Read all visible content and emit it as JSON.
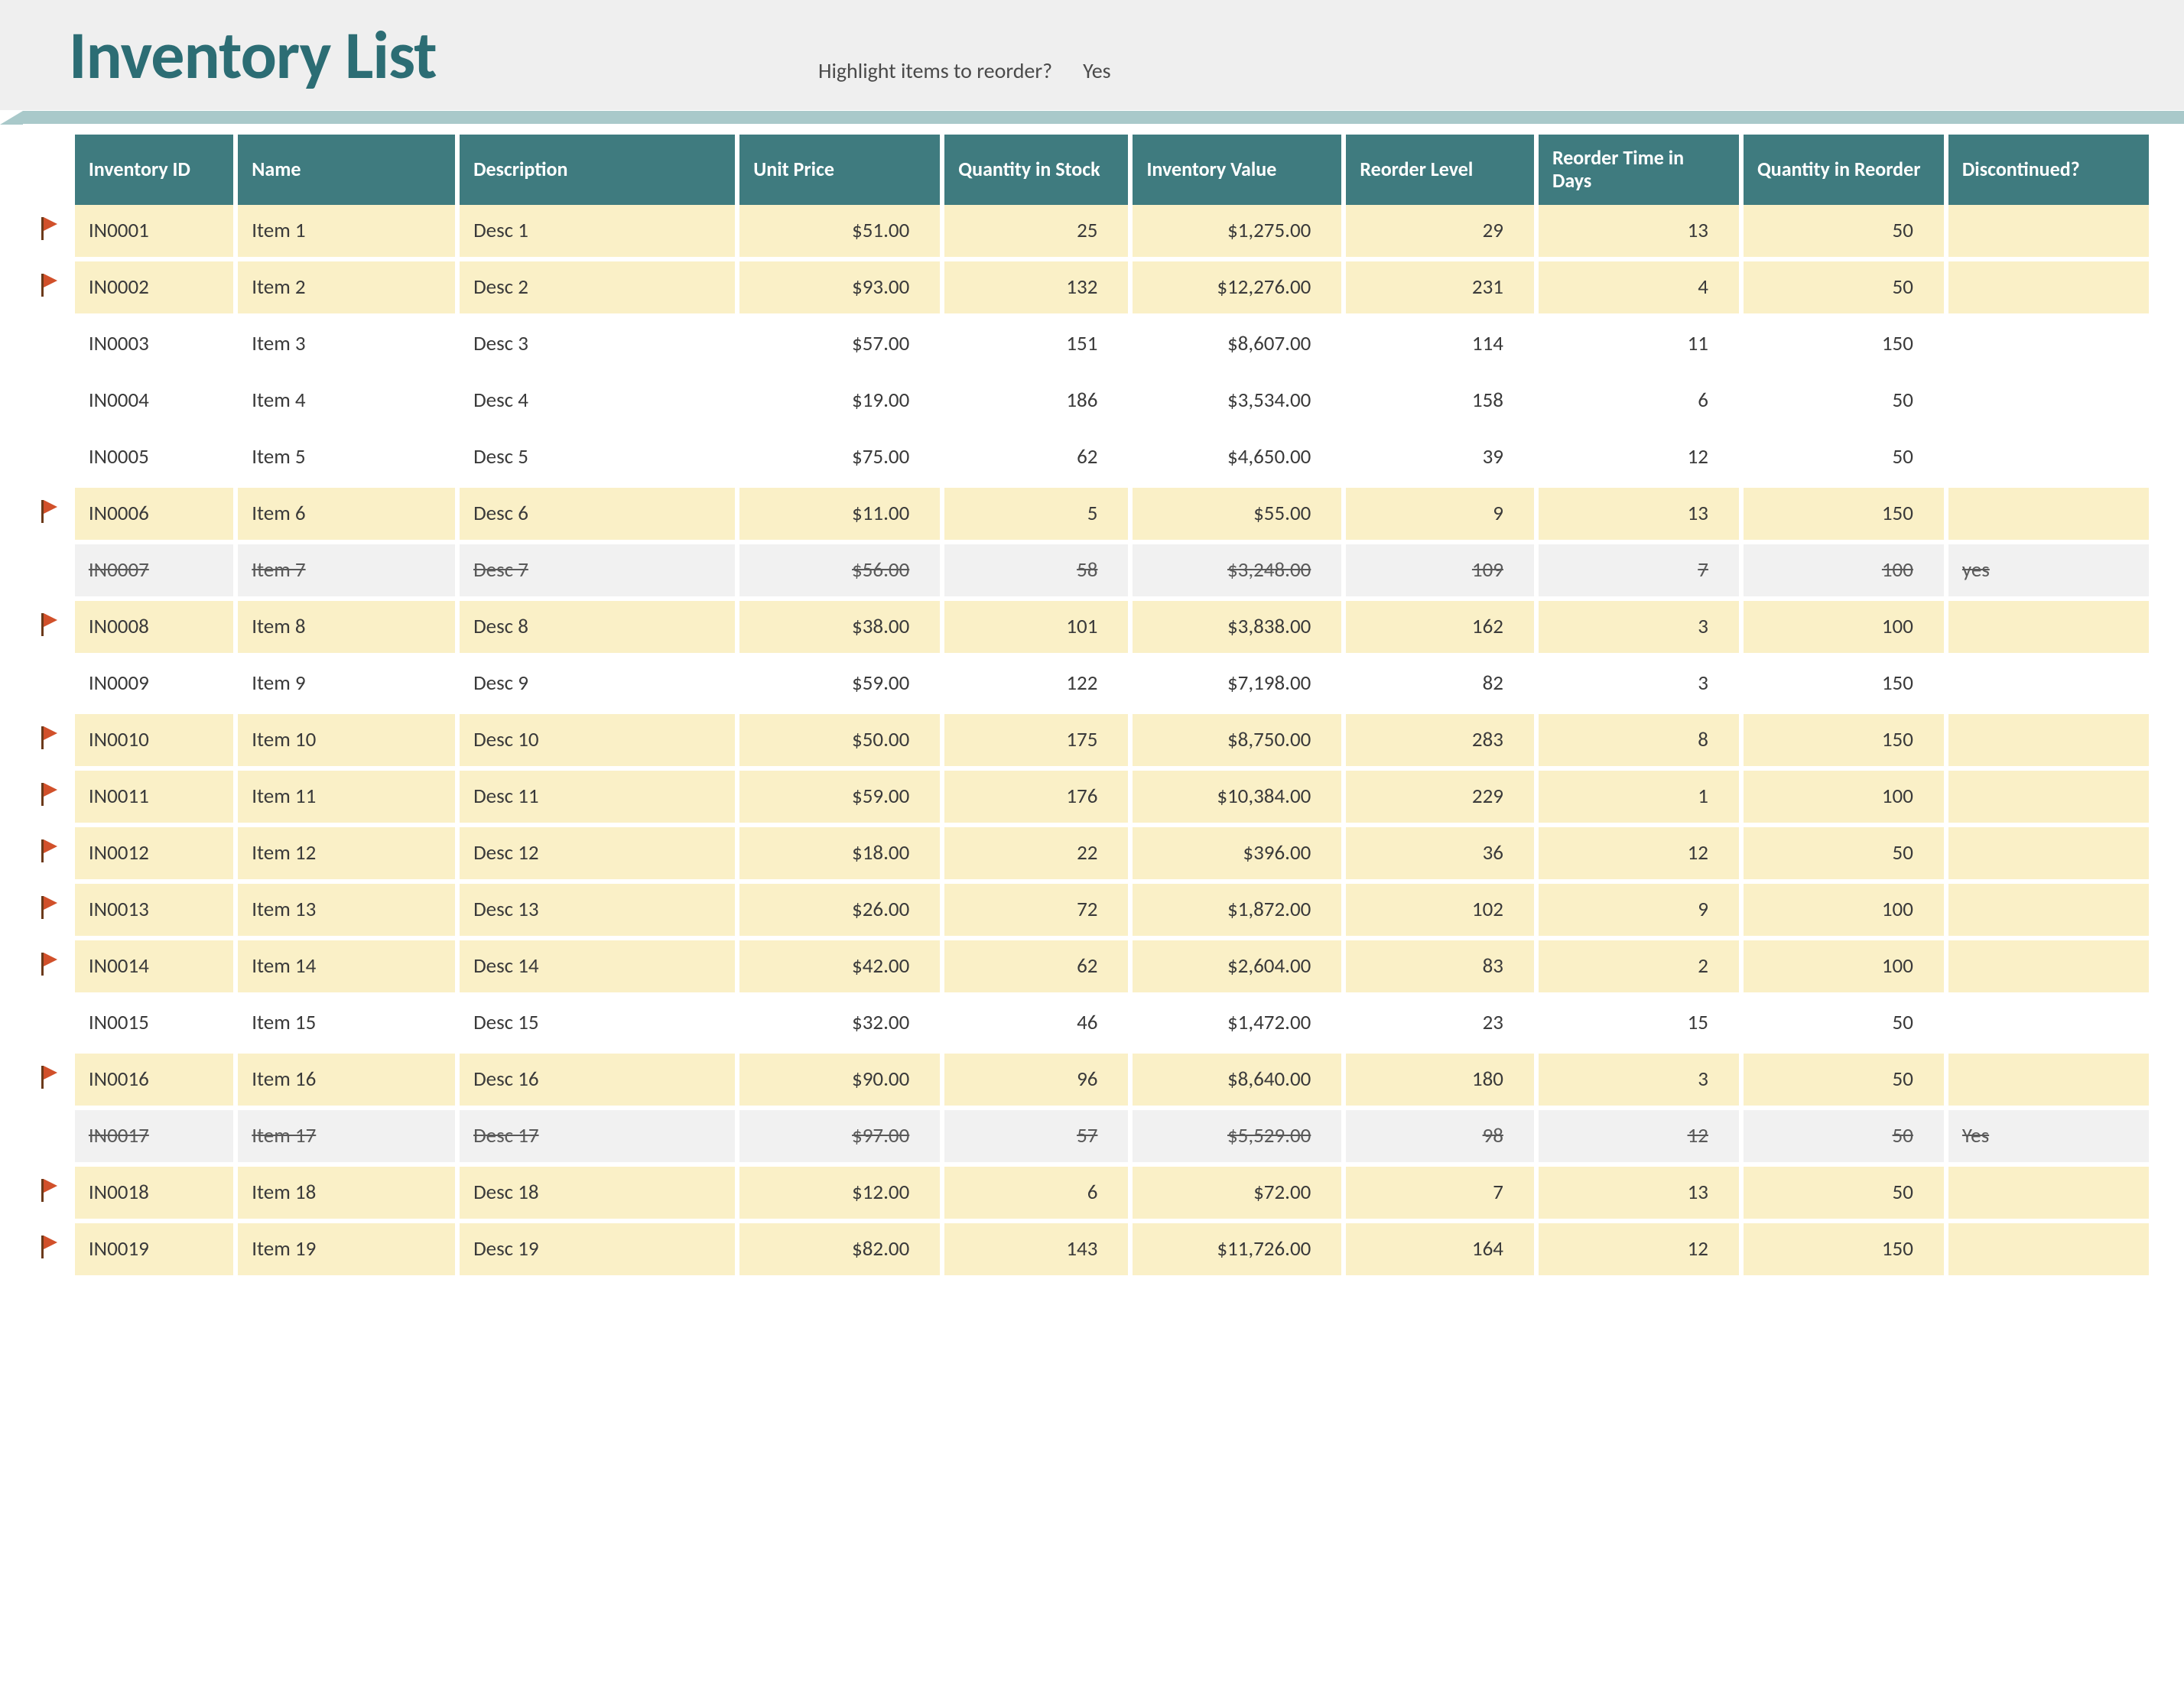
{
  "title": "Inventory List",
  "highlight": {
    "label": "Highlight items to reorder?",
    "value": "Yes"
  },
  "columns": {
    "id": "Inventory ID",
    "name": "Name",
    "desc": "Description",
    "price": "Unit Price",
    "stock": "Quantity in Stock",
    "value": "Inventory Value",
    "reorder": "Reorder Level",
    "rtime": "Reorder Time in Days",
    "qreorder": "Quantity in Reorder",
    "disc": "Discontinued?"
  },
  "rows": [
    {
      "flag": true,
      "hi": true,
      "id": "IN0001",
      "name": "Item 1",
      "desc": "Desc 1",
      "price": "$51.00",
      "stock": "25",
      "value": "$1,275.00",
      "reorder": "29",
      "rtime": "13",
      "qreorder": "50",
      "disc": ""
    },
    {
      "flag": true,
      "hi": true,
      "id": "IN0002",
      "name": "Item 2",
      "desc": "Desc 2",
      "price": "$93.00",
      "stock": "132",
      "value": "$12,276.00",
      "reorder": "231",
      "rtime": "4",
      "qreorder": "50",
      "disc": ""
    },
    {
      "flag": false,
      "hi": false,
      "id": "IN0003",
      "name": "Item 3",
      "desc": "Desc 3",
      "price": "$57.00",
      "stock": "151",
      "value": "$8,607.00",
      "reorder": "114",
      "rtime": "11",
      "qreorder": "150",
      "disc": ""
    },
    {
      "flag": false,
      "hi": false,
      "id": "IN0004",
      "name": "Item 4",
      "desc": "Desc 4",
      "price": "$19.00",
      "stock": "186",
      "value": "$3,534.00",
      "reorder": "158",
      "rtime": "6",
      "qreorder": "50",
      "disc": ""
    },
    {
      "flag": false,
      "hi": false,
      "id": "IN0005",
      "name": "Item 5",
      "desc": "Desc 5",
      "price": "$75.00",
      "stock": "62",
      "value": "$4,650.00",
      "reorder": "39",
      "rtime": "12",
      "qreorder": "50",
      "disc": ""
    },
    {
      "flag": true,
      "hi": true,
      "id": "IN0006",
      "name": "Item 6",
      "desc": "Desc 6",
      "price": "$11.00",
      "stock": "5",
      "value": "$55.00",
      "reorder": "9",
      "rtime": "13",
      "qreorder": "150",
      "disc": ""
    },
    {
      "flag": false,
      "disc_row": true,
      "id": "IN0007",
      "name": "Item 7",
      "desc": "Desc 7",
      "price": "$56.00",
      "stock": "58",
      "value": "$3,248.00",
      "reorder": "109",
      "rtime": "7",
      "qreorder": "100",
      "disc": "yes"
    },
    {
      "flag": true,
      "hi": true,
      "id": "IN0008",
      "name": "Item 8",
      "desc": "Desc 8",
      "price": "$38.00",
      "stock": "101",
      "value": "$3,838.00",
      "reorder": "162",
      "rtime": "3",
      "qreorder": "100",
      "disc": ""
    },
    {
      "flag": false,
      "hi": false,
      "id": "IN0009",
      "name": "Item 9",
      "desc": "Desc 9",
      "price": "$59.00",
      "stock": "122",
      "value": "$7,198.00",
      "reorder": "82",
      "rtime": "3",
      "qreorder": "150",
      "disc": ""
    },
    {
      "flag": true,
      "hi": true,
      "id": "IN0010",
      "name": "Item 10",
      "desc": "Desc 10",
      "price": "$50.00",
      "stock": "175",
      "value": "$8,750.00",
      "reorder": "283",
      "rtime": "8",
      "qreorder": "150",
      "disc": ""
    },
    {
      "flag": true,
      "hi": true,
      "id": "IN0011",
      "name": "Item 11",
      "desc": "Desc 11",
      "price": "$59.00",
      "stock": "176",
      "value": "$10,384.00",
      "reorder": "229",
      "rtime": "1",
      "qreorder": "100",
      "disc": ""
    },
    {
      "flag": true,
      "hi": true,
      "id": "IN0012",
      "name": "Item 12",
      "desc": "Desc 12",
      "price": "$18.00",
      "stock": "22",
      "value": "$396.00",
      "reorder": "36",
      "rtime": "12",
      "qreorder": "50",
      "disc": ""
    },
    {
      "flag": true,
      "hi": true,
      "id": "IN0013",
      "name": "Item 13",
      "desc": "Desc 13",
      "price": "$26.00",
      "stock": "72",
      "value": "$1,872.00",
      "reorder": "102",
      "rtime": "9",
      "qreorder": "100",
      "disc": ""
    },
    {
      "flag": true,
      "hi": true,
      "id": "IN0014",
      "name": "Item 14",
      "desc": "Desc 14",
      "price": "$42.00",
      "stock": "62",
      "value": "$2,604.00",
      "reorder": "83",
      "rtime": "2",
      "qreorder": "100",
      "disc": ""
    },
    {
      "flag": false,
      "hi": false,
      "id": "IN0015",
      "name": "Item 15",
      "desc": "Desc 15",
      "price": "$32.00",
      "stock": "46",
      "value": "$1,472.00",
      "reorder": "23",
      "rtime": "15",
      "qreorder": "50",
      "disc": ""
    },
    {
      "flag": true,
      "hi": true,
      "id": "IN0016",
      "name": "Item 16",
      "desc": "Desc 16",
      "price": "$90.00",
      "stock": "96",
      "value": "$8,640.00",
      "reorder": "180",
      "rtime": "3",
      "qreorder": "50",
      "disc": ""
    },
    {
      "flag": false,
      "disc_row": true,
      "id": "IN0017",
      "name": "Item 17",
      "desc": "Desc 17",
      "price": "$97.00",
      "stock": "57",
      "value": "$5,529.00",
      "reorder": "98",
      "rtime": "12",
      "qreorder": "50",
      "disc": "Yes"
    },
    {
      "flag": true,
      "hi": true,
      "id": "IN0018",
      "name": "Item 18",
      "desc": "Desc 18",
      "price": "$12.00",
      "stock": "6",
      "value": "$72.00",
      "reorder": "7",
      "rtime": "13",
      "qreorder": "50",
      "disc": ""
    },
    {
      "flag": true,
      "hi": true,
      "id": "IN0019",
      "name": "Item 19",
      "desc": "Desc 19",
      "price": "$82.00",
      "stock": "143",
      "value": "$11,726.00",
      "reorder": "164",
      "rtime": "12",
      "qreorder": "150",
      "disc": ""
    }
  ]
}
